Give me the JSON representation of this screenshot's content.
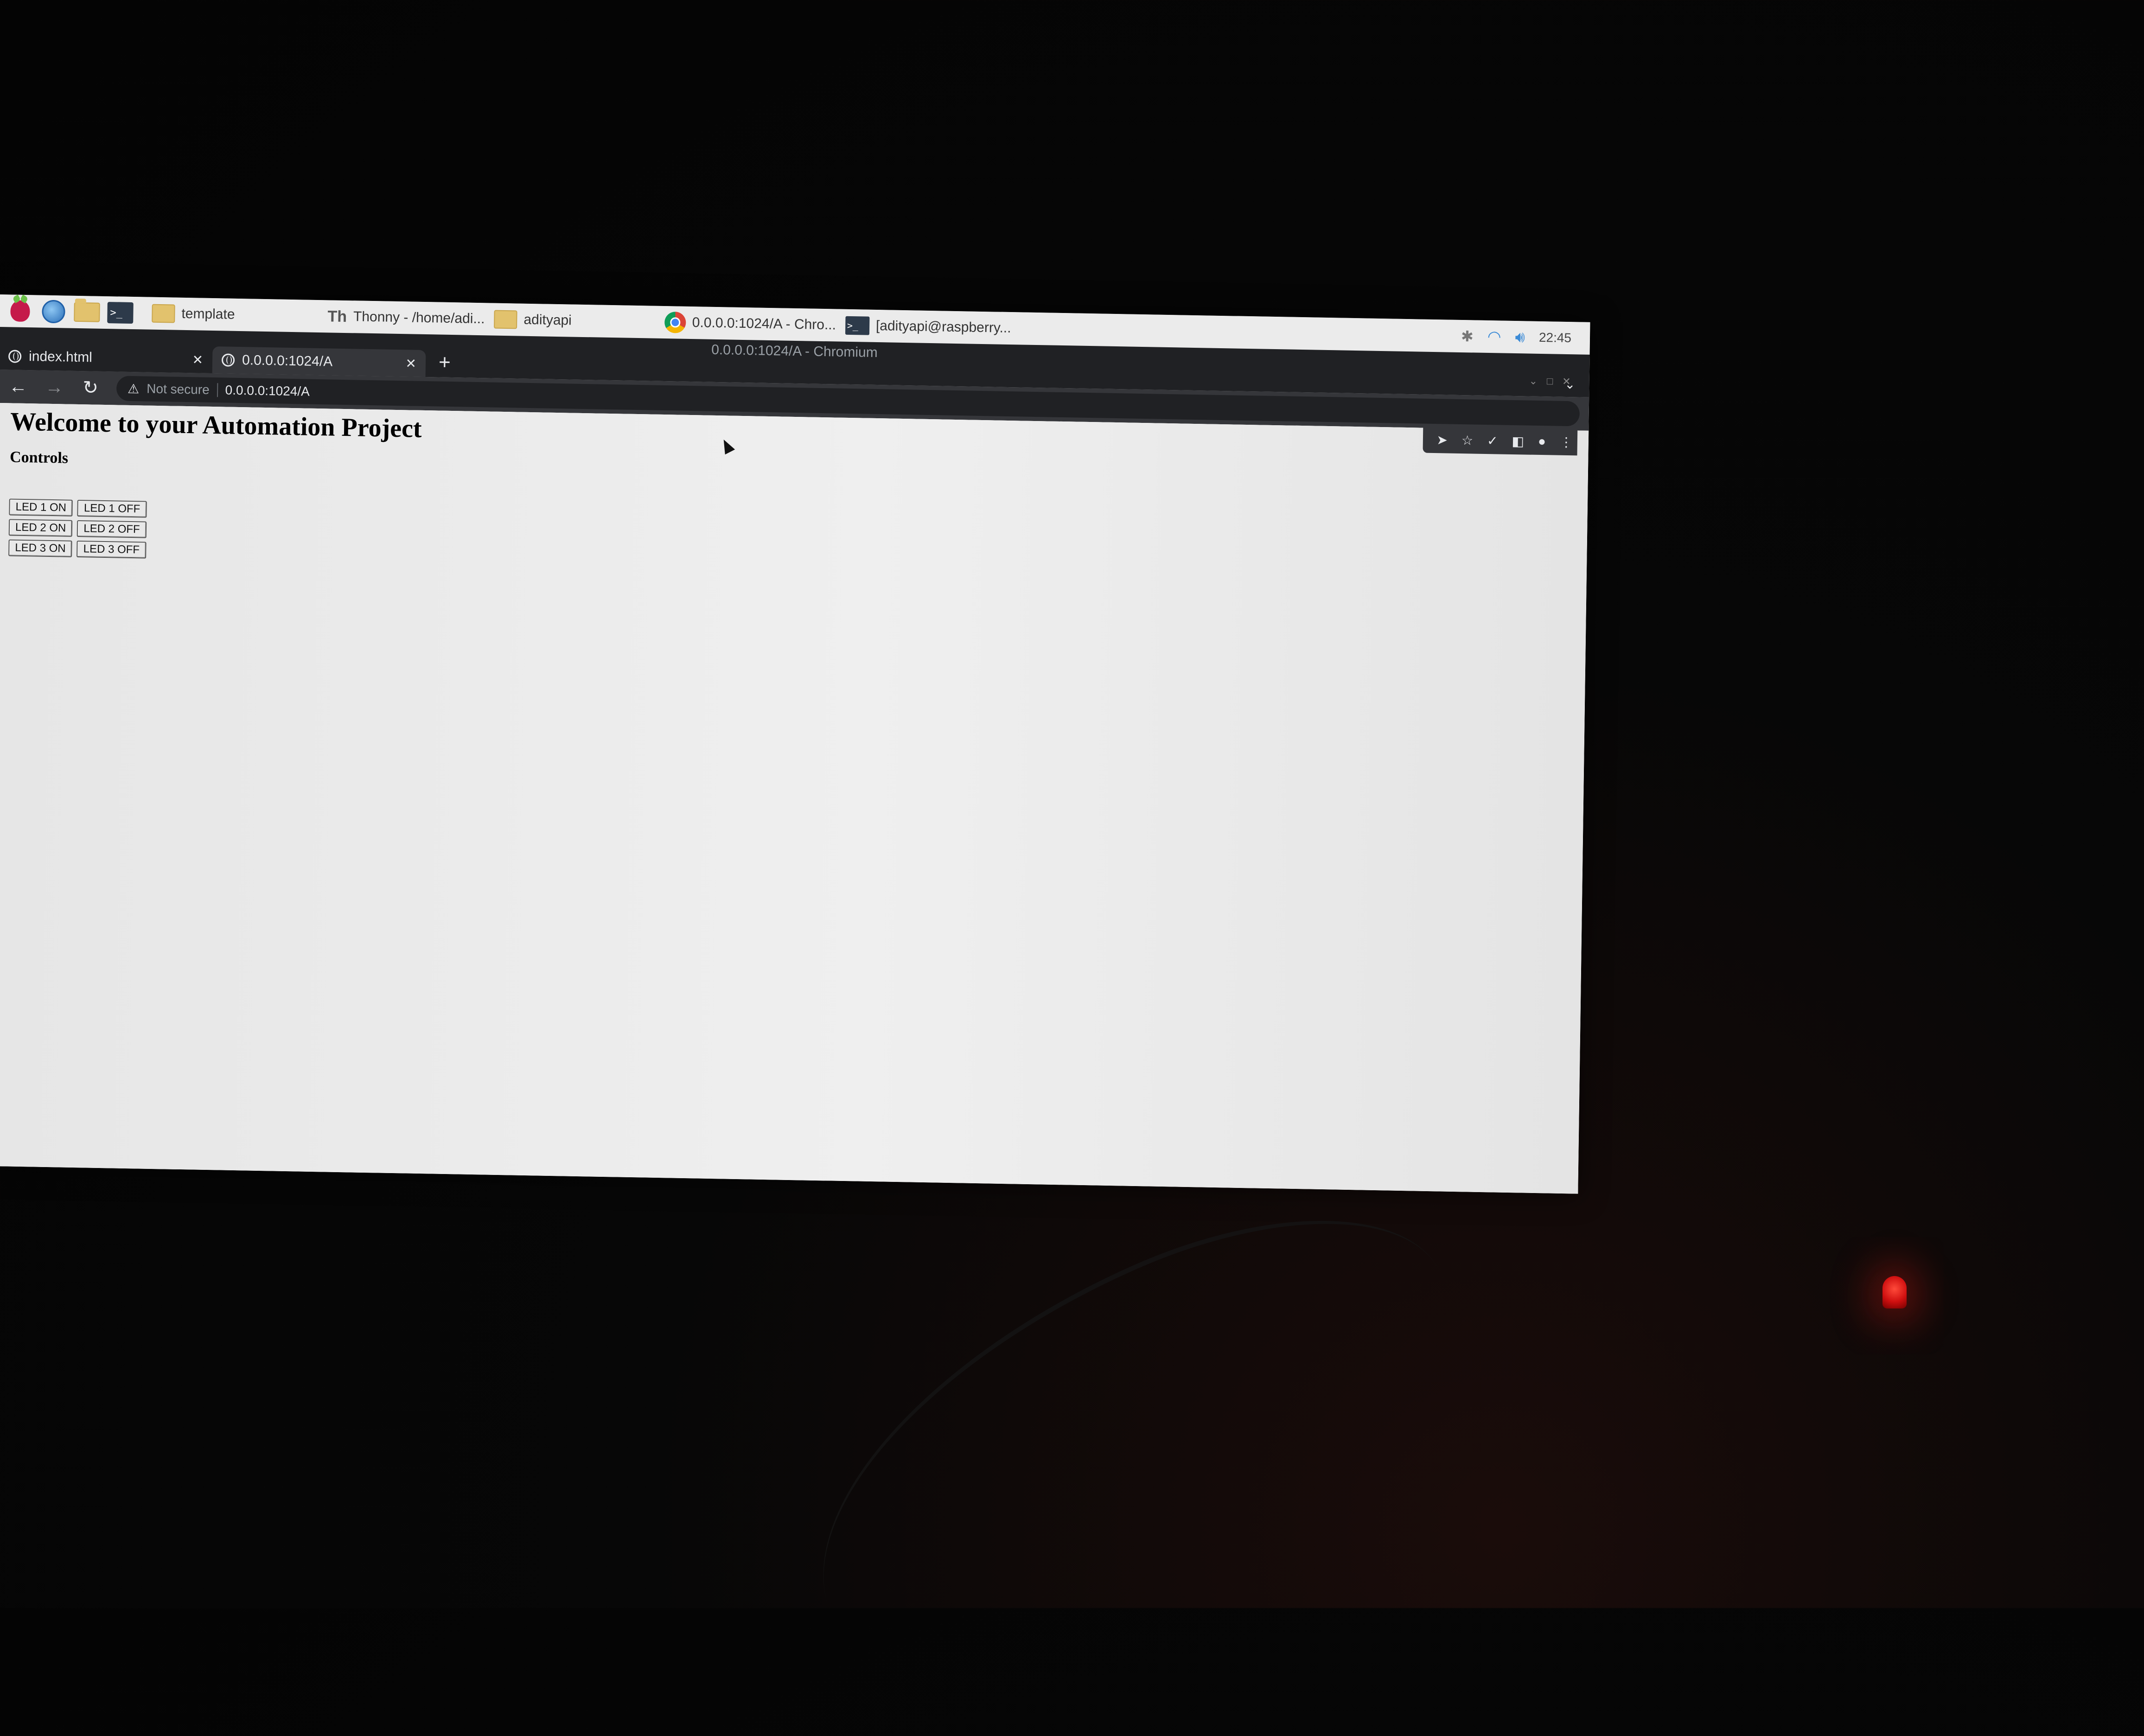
{
  "taskbar": {
    "items": [
      {
        "label": "template"
      },
      {
        "label": "Thonny  -  /home/adi..."
      },
      {
        "label": "adityapi"
      },
      {
        "label": "0.0.0.0:1024/A - Chro..."
      },
      {
        "label": "[adityapi@raspberry..."
      }
    ],
    "clock": "22:45"
  },
  "browser": {
    "window_title": "0.0.0.0:1024/A - Chromium",
    "tabs": [
      {
        "title": "index.html",
        "active": false
      },
      {
        "title": "0.0.0.0:1024/A",
        "active": true
      }
    ],
    "address": {
      "security_label": "Not secure",
      "url": "0.0.0.0:1024/A"
    }
  },
  "page": {
    "heading": "Welcome to your Automation Project",
    "subheading": "Controls",
    "buttons": [
      {
        "on": "LED 1 ON",
        "off": "LED 1 OFF"
      },
      {
        "on": "LED 2 ON",
        "off": "LED 2 OFF"
      },
      {
        "on": "LED 3 ON",
        "off": "LED 3 OFF"
      }
    ]
  }
}
